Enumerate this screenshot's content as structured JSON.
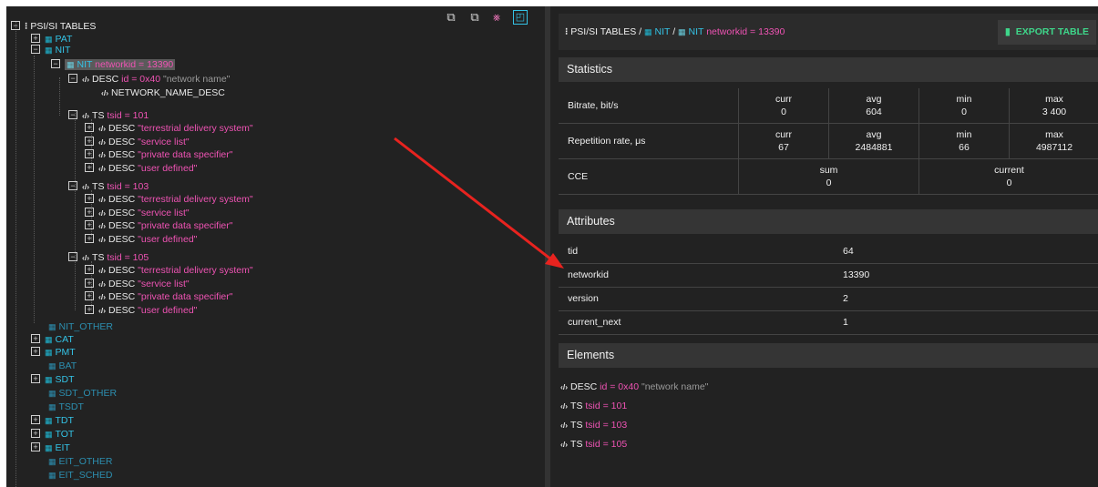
{
  "tree": {
    "root": "PSI/SI TABLES",
    "pat": "PAT",
    "nit": "NIT",
    "nit_sel_name": "NIT",
    "nit_sel_attr": "networkid = 13390",
    "desc1_name": "DESC",
    "desc1_attr": "id = 0x40",
    "desc1_str": "\"network name\"",
    "network_name_desc": "NETWORK_NAME_DESC",
    "ts": [
      {
        "name": "TS",
        "attr": "tsid = 101",
        "items": [
          "\"terrestrial delivery system\"",
          "\"service list\"",
          "\"private data specifier\"",
          "\"user defined\""
        ]
      },
      {
        "name": "TS",
        "attr": "tsid = 103",
        "items": [
          "\"terrestrial delivery system\"",
          "\"service list\"",
          "\"private data specifier\"",
          "\"user defined\""
        ]
      },
      {
        "name": "TS",
        "attr": "tsid = 105",
        "items": [
          "\"terrestrial delivery system\"",
          "\"service list\"",
          "\"private data specifier\"",
          "\"user defined\""
        ]
      }
    ],
    "desc_label": "DESC",
    "nit_other": "NIT_OTHER",
    "cat": "CAT",
    "pmt": "PMT",
    "bat": "BAT",
    "sdt": "SDT",
    "sdt_other": "SDT_OTHER",
    "tsdt": "TSDT",
    "tdt": "TDT",
    "tot": "TOT",
    "eit": "EIT",
    "eit_other": "EIT_OTHER",
    "eit_sched": "EIT_SCHED"
  },
  "toolbar": {
    "icons": [
      "expand-all-icon",
      "collapse-all-icon",
      "hide-empty-icon",
      "select-mode-icon"
    ]
  },
  "breadcrumb": {
    "root": "PSI/SI TABLES",
    "sep": "/",
    "table": "NIT",
    "current": "NIT",
    "current_attr": "networkid = 13390"
  },
  "export_label": "EXPORT TABLE",
  "statistics": {
    "title": "Statistics",
    "bitrate": {
      "label": "Bitrate, bit/s",
      "curr": "0",
      "avg": "604",
      "min": "0",
      "max": "3 400"
    },
    "repetition": {
      "label": "Repetition rate, μs",
      "curr": "67",
      "avg": "2484881",
      "min": "66",
      "max": "4987112"
    },
    "cce": {
      "label": "CCE",
      "sum": "0",
      "current": "0"
    },
    "h_curr": "curr",
    "h_avg": "avg",
    "h_min": "min",
    "h_max": "max",
    "h_sum": "sum",
    "h_current": "current"
  },
  "attributes": {
    "title": "Attributes",
    "rows": [
      {
        "key": "tid",
        "value": "64"
      },
      {
        "key": "networkid",
        "value": "13390"
      },
      {
        "key": "version",
        "value": "2"
      },
      {
        "key": "current_next",
        "value": "1"
      }
    ]
  },
  "elements": {
    "title": "Elements",
    "rows": [
      {
        "name": "DESC",
        "attr": "id = 0x40",
        "extra": "\"network name\""
      },
      {
        "name": "TS",
        "attr": "tsid = 101",
        "extra": ""
      },
      {
        "name": "TS",
        "attr": "tsid = 103",
        "extra": ""
      },
      {
        "name": "TS",
        "attr": "tsid = 105",
        "extra": ""
      }
    ]
  },
  "colors": {
    "accent_blue": "#34c3e6",
    "accent_pink": "#ef53b4",
    "export_green": "#3ed68a",
    "background": "#222222",
    "arrow": "#e8231f"
  }
}
